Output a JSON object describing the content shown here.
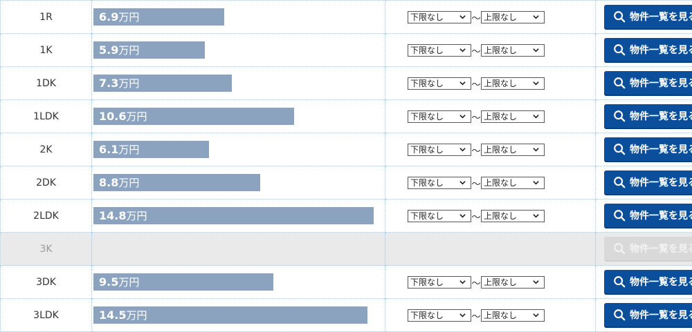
{
  "filter": {
    "min_label": "下限なし",
    "max_label": "上限なし",
    "separator": "～"
  },
  "button_label": "物件一覧を見る",
  "unit": "万円",
  "colors": {
    "bar": "#8ca3bf",
    "button": "#0b4f9c",
    "disabled_row": "#eaeaea"
  },
  "chart_data": {
    "type": "bar",
    "categories": [
      "1R",
      "1K",
      "1DK",
      "1LDK",
      "2K",
      "2DK",
      "2LDK",
      "3K",
      "3DK",
      "3LDK"
    ],
    "values": [
      6.9,
      5.9,
      7.3,
      10.6,
      6.1,
      8.8,
      14.8,
      null,
      9.5,
      14.5
    ],
    "value_labels": [
      "6.9",
      "5.9",
      "7.3",
      "10.6",
      "6.1",
      "8.8",
      "14.8",
      "",
      "9.5",
      "14.5"
    ],
    "unit": "万円",
    "xlim": [
      0,
      15
    ]
  }
}
